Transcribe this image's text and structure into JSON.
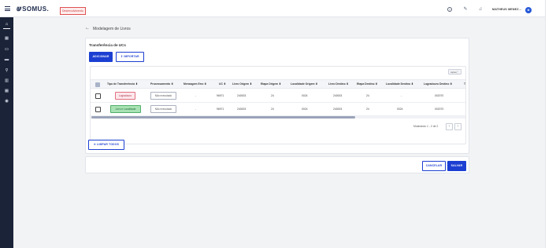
{
  "header": {
    "logo_text": "somus.",
    "environment_badge": "Desenvolvimento",
    "user_name": "MATHEUS MENEZ...",
    "avatar_initials": "M"
  },
  "sidebar": {
    "items": [
      {
        "icon": "home-icon",
        "glyph": "⌂"
      },
      {
        "icon": "grid-icon",
        "glyph": "▦"
      },
      {
        "icon": "card-icon",
        "glyph": "▭"
      },
      {
        "icon": "monitor-icon",
        "glyph": "▬"
      },
      {
        "icon": "search-people-icon",
        "glyph": "⚲"
      },
      {
        "icon": "building-icon",
        "glyph": "▥"
      },
      {
        "icon": "apps-icon",
        "glyph": "▦"
      },
      {
        "icon": "settings-icon",
        "glyph": "◉"
      }
    ]
  },
  "page": {
    "title": "Modelagem de Livros"
  },
  "card": {
    "title": "Transferência de UCs",
    "add_button": "ADICIONAR",
    "import_button": "IMPORTAR",
    "table_chip": "Ações",
    "columns": [
      "Tipo de Transferência",
      "Processamento",
      "Mensagem Erro",
      "UC",
      "Livro Origem",
      "Etapa Origem",
      "Localidade Origem",
      "Livro Destino",
      "Etapa Destino",
      "Localidade Destino",
      "Logradouro Destino",
      "T"
    ],
    "rows": [
      {
        "tipo": "Logradouro",
        "processamento": "Não executado",
        "mensagem": "-",
        "uc": "96971",
        "livro_origem": "240003",
        "etapa_origem": "24",
        "localidade_origem": "0024",
        "livro_destino": "240003",
        "etapa_destino": "24",
        "localidade_destino": "-",
        "logradouro_destino": "002070"
      },
      {
        "tipo": "Livro e Localidade",
        "processamento": "Não executado",
        "mensagem": "-",
        "uc": "96971",
        "livro_origem": "240003",
        "etapa_origem": "24",
        "localidade_origem": "0024",
        "livro_destino": "240003",
        "etapa_destino": "24",
        "localidade_destino": "0024",
        "logradouro_destino": "002070"
      }
    ],
    "pagination_text": "Mostrando 1 - 2 de 2",
    "clear_button": "LIMPAR TODOS"
  },
  "footer": {
    "cancel_button": "CANCELAR",
    "save_button": "SALVAR"
  },
  "colors": {
    "primary": "#1c3fd2",
    "sidebar": "#1b2338",
    "tag_red": "#fde8ec",
    "tag_green": "#a8e2b4"
  }
}
